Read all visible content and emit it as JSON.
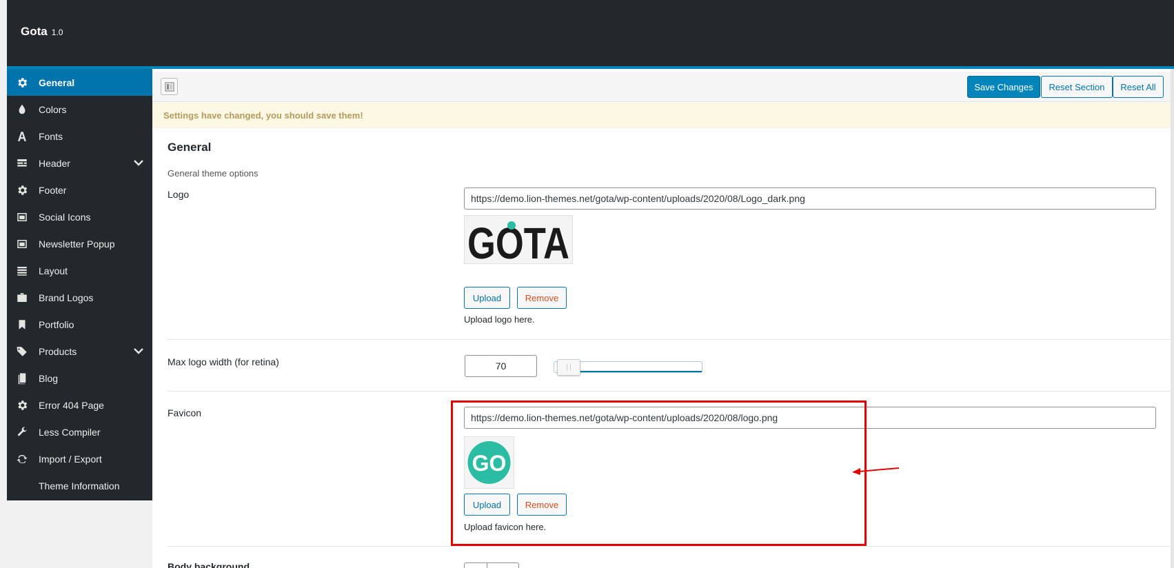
{
  "app": {
    "title": "Gota",
    "version": "1.0"
  },
  "sidebar": {
    "items": [
      {
        "label": "General",
        "icon": "gear-icon",
        "active": true
      },
      {
        "label": "Colors",
        "icon": "droplet-icon"
      },
      {
        "label": "Fonts",
        "icon": "font-icon"
      },
      {
        "label": "Header",
        "icon": "header-icon",
        "expandable": true
      },
      {
        "label": "Footer",
        "icon": "gear-icon"
      },
      {
        "label": "Social Icons",
        "icon": "window-icon"
      },
      {
        "label": "Newsletter Popup",
        "icon": "window-icon"
      },
      {
        "label": "Layout",
        "icon": "list-icon"
      },
      {
        "label": "Brand Logos",
        "icon": "briefcase-icon"
      },
      {
        "label": "Portfolio",
        "icon": "bookmark-icon"
      },
      {
        "label": "Products",
        "icon": "tags-icon",
        "expandable": true
      },
      {
        "label": "Blog",
        "icon": "file-icon"
      },
      {
        "label": "Error 404 Page",
        "icon": "gear-icon"
      },
      {
        "label": "Less Compiler",
        "icon": "wrench-icon"
      },
      {
        "label": "Import / Export",
        "icon": "refresh-icon"
      },
      {
        "label": "Theme Information",
        "icon": ""
      }
    ]
  },
  "toolbar": {
    "save_label": "Save Changes",
    "reset_section_label": "Reset Section",
    "reset_all_label": "Reset All"
  },
  "notice": {
    "text": "Settings have changed, you should save them!"
  },
  "section": {
    "title": "General",
    "description": "General theme options"
  },
  "fields": {
    "logo": {
      "label": "Logo",
      "url": "https://demo.lion-themes.net/gota/wp-content/uploads/2020/08/Logo_dark.png",
      "preview_text": "GOTA",
      "upload_label": "Upload",
      "remove_label": "Remove",
      "help": "Upload logo here."
    },
    "max_logo_width": {
      "label": "Max logo width (for retina)",
      "value": "70",
      "slider_fraction": 0.02
    },
    "favicon": {
      "label": "Favicon",
      "url": "https://demo.lion-themes.net/gota/wp-content/uploads/2020/08/logo.png",
      "preview_text": "GO",
      "upload_label": "Upload",
      "remove_label": "Remove",
      "help": "Upload favicon here."
    },
    "body_background": {
      "label": "Body background"
    }
  },
  "colors": {
    "accent": "#0085ba",
    "favicon_bg": "#2bbca4",
    "logo_dot": "#2bbca4",
    "highlight": "#e00000"
  }
}
